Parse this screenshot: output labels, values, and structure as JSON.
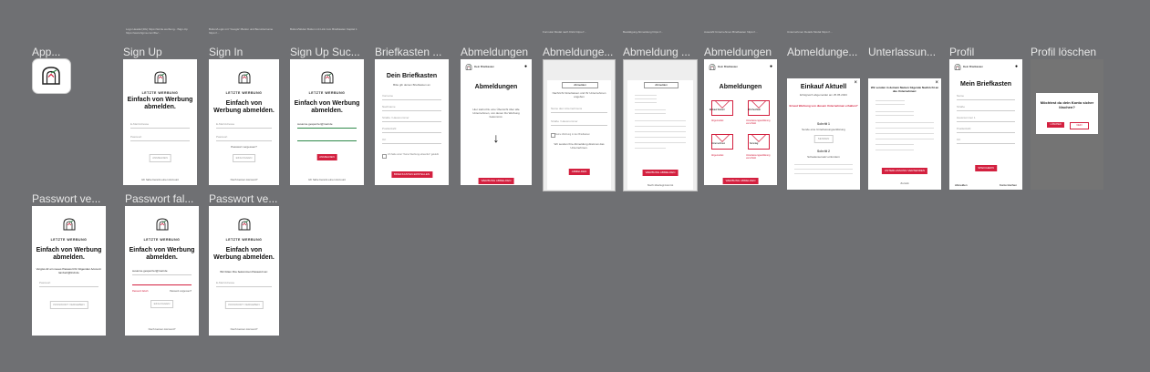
{
  "frames": {
    "app": {
      "label": "App..."
    },
    "signup": {
      "label": "Sign Up",
      "note": "Logo Header(40x) https://letzte.werbung.../Sign-Up https://www.figma.com/file/...",
      "brand": "LETZTE WERBUNG",
      "title": "Einfach von Werbung abmelden.",
      "email": "E-Mail Adresse",
      "password": "Passwort",
      "button": "ANMELDEN",
      "footer": "Ich habe bereits einen Account"
    },
    "signin": {
      "label": "Sign In",
      "note": "Button/Login mit \"Google\"-Button und Benutzername https://...",
      "brand": "LETZTE WERBUNG",
      "title": "Einfach von Werbung abmelden.",
      "email": "E-Mail Adresse",
      "password": "Passwort",
      "forgot": "Passwort vergessen?",
      "button": "EINLOGGEN",
      "footer": "Noch keinen Account?"
    },
    "signupsuccess": {
      "label": "Sign Up Suc...",
      "note": "Button/Weiter Button mit Link zum Briefkasten Kapitel 1",
      "brand": "LETZTE WERBUNG",
      "title": "Einfach von Werbung abmelden.",
      "email": "susanne.gesperrter@mail.de",
      "button": "ANMELDEN",
      "footer": "Ich habe bereits einen Account"
    },
    "briefkasten": {
      "label": "Briefkasten ...",
      "title": "Dein Briefkasten",
      "subtitle": "Bitte gib deinen Briefkasten an",
      "fields": [
        "Vorname",
        "Nachname",
        "Straße / Hausnummer",
        "Postleitzahl",
        "Ort"
      ],
      "check": "Ich habe unter \"Keine Werbung einwerfen\" geklebt",
      "button": "BRIEFKASTEN ERSTELLEN"
    },
    "abmeldungen1": {
      "label": "Abmeldungen",
      "header": "Dein Briefkasten",
      "title": "Abmeldungen",
      "text": "Hier siehst Du eine Übersicht über alle Unternehmen, von denen Du Werbung bekommst.",
      "arrow": "↓",
      "button": "WERBUNG ABMELDEN"
    },
    "abmeldungeform": {
      "label": "Abmeldunge...",
      "note": "Formular Modal nach Klick https://...",
      "header": "Abmelden",
      "text": "Nachricht hinterlassen und Ihr Unternehmen angeben",
      "fields": [
        "Name des Unternehmens",
        "Straße / Hausnummer"
      ],
      "check": "Keine Werbung in den Briefkasten",
      "text2": "Wir senden Ihre Abmeldung direkt an das Unternehmen.",
      "button": "ABMELDEN"
    },
    "abmeldungletter": {
      "label": "Abmeldung ...",
      "note": "Bestätigung Abmeldung https://...",
      "header": "Abmelden",
      "button": "WERBUNG ABMELDEN",
      "footer": "Noch überlegt kommt"
    },
    "abmeldungen2": {
      "label": "Abmeldungen",
      "note": "Auswahl Unternehmen Briefkasten https://...",
      "header": "Dein Briefkasten",
      "title": "Abmeldungen",
      "items": [
        "Einkauf Aktuell",
        "Wochenblatt",
        "Unternehmen",
        "Sonntag",
        "Unternehmensgruppe",
        "Ostseebilder"
      ],
      "status": [
        "Abgemeldet",
        "Unterlassungserklärung verschickt",
        "Abgemeldet",
        "Unterlassungserklärung verschickt"
      ],
      "button": "WERBUNG ABMELDEN"
    },
    "abmeldungedetail": {
      "label": "Abmeldunge...",
      "note": "Unternehmen Details Modal https://...",
      "title": "Einkauf Aktuell",
      "subtitle": "Erfolgreich abgemeldet am 25.05.2023",
      "question": "Erneut Werbung von diesem Unternehmen erhalten?",
      "step1": "Schritt 1",
      "step1text": "Sende eine Unterlassungserklärung",
      "step1btn": "SENDEN",
      "step2": "Schritt 2",
      "step2text": "Schadensersatz einfordern"
    },
    "unterlassung": {
      "label": "Unterlassun...",
      "title": "Wir senden in deinem Namen folgende Nachricht an das Unternehmen:",
      "button": "UNTERLASSUNG VERSENDEN",
      "footer": "Zurück"
    },
    "profil": {
      "label": "Profil",
      "header": "Dein Briefkasten",
      "title": "Mein Briefkasten",
      "fields": [
        "Name",
        "Straße",
        "Hausnummer 1",
        "Postleitzahl",
        "Ort"
      ],
      "button": "SPEICHERN",
      "footer_left": "Abmelden",
      "footer_right": "Konto löschen"
    },
    "profilloeschen": {
      "label": "Profil löschen",
      "question": "Möchtest du dein Konto sicher löschen?",
      "yes": "LÖSCHEN",
      "no": "NEIN"
    },
    "pwvergessen": {
      "label": "Passwort ve...",
      "brand": "LETZTE WERBUNG",
      "title": "Einfach von Werbung abmelden.",
      "text": "Vergiss dir ein neues Passwort für folgenden Account: lambert@lindi.de",
      "password": "Passwort",
      "button": "PASSWORT VERGEBEN"
    },
    "pwfalsch": {
      "label": "Passwort fal...",
      "brand": "LETZTE WERBUNG",
      "title": "Einfach von Werbung abmelden.",
      "email": "susanne.gesperrter@mail.de",
      "error": "Passwort falsch",
      "forgot": "Passwort vergessen?",
      "button": "EINLOGGEN",
      "footer": "Noch keinen Account?"
    },
    "pwvergessen2": {
      "label": "Passwort ve...",
      "brand": "LETZTE WERBUNG",
      "title": "Einfach von Werbung abmelden.",
      "text": "Wir bitten Ihre bekommen Passwort an:",
      "email": "E-Mail Adresse",
      "button": "PASSWORT VERGEBEN",
      "footer": "Noch keinen Account?"
    }
  },
  "colors": {
    "accent": "#d3203f",
    "canvas": "#6f7073"
  }
}
